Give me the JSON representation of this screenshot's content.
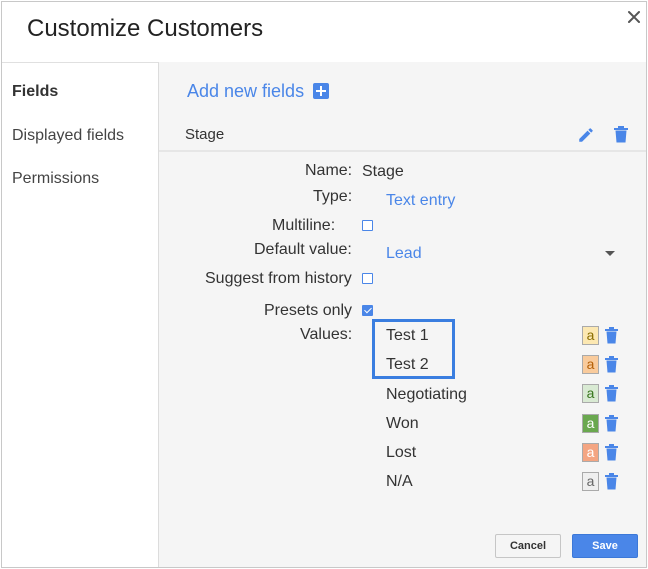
{
  "dialog": {
    "title": "Customize Customers"
  },
  "sidebar": {
    "items": [
      {
        "label": "Fields",
        "active": true
      },
      {
        "label": "Displayed fields",
        "active": false
      },
      {
        "label": "Permissions",
        "active": false
      }
    ]
  },
  "main": {
    "add_fields_label": "Add new fields",
    "field_header": "Stage",
    "form": {
      "name_label": "Name:",
      "name_value": "Stage",
      "type_label": "Type:",
      "type_value": "Text entry",
      "multiline_label": "Multiline:",
      "multiline_checked": false,
      "default_label": "Default value:",
      "default_value": "Lead",
      "suggest_label": "Suggest from history",
      "suggest_checked": false,
      "presets_label": "Presets only",
      "presets_checked": true,
      "values_label": "Values:"
    },
    "values": [
      {
        "label": "Test 1",
        "swatch": "a",
        "color": "#fce8b2",
        "text_color": "#8a6d00"
      },
      {
        "label": "Test 2",
        "swatch": "a",
        "color": "#f9cb9c",
        "text_color": "#b45f06"
      },
      {
        "label": "Negotiating",
        "swatch": "a",
        "color": "#d9ead3",
        "text_color": "#38761d"
      },
      {
        "label": "Won",
        "swatch": "a",
        "color": "#6aa84f",
        "text_color": "#ffffff"
      },
      {
        "label": "Lost",
        "swatch": "a",
        "color": "#f4a582",
        "text_color": "#ffffff"
      },
      {
        "label": "N/A",
        "swatch": "a",
        "color": "#efefef",
        "text_color": "#666666"
      }
    ]
  },
  "buttons": {
    "cancel": "Cancel",
    "save": "Save"
  },
  "colors": {
    "accent": "#4a86e8",
    "highlight": "#3a7ee0"
  }
}
